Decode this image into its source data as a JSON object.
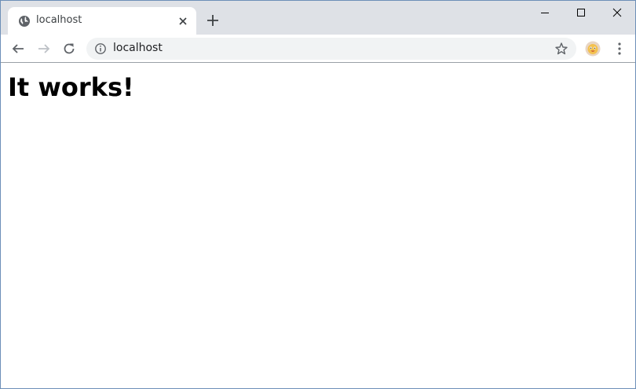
{
  "tab": {
    "title": "localhost",
    "favicon": "globe-icon"
  },
  "omnibox": {
    "url": "localhost",
    "info_icon": "info-icon"
  },
  "window_controls": [
    "minimize-icon",
    "maximize-icon",
    "close-icon"
  ],
  "colors": {
    "titlebar": "#dee1e6",
    "omnibox": "#f1f3f4",
    "window_border": "#6d8fb8"
  },
  "page": {
    "heading": "It works!"
  }
}
